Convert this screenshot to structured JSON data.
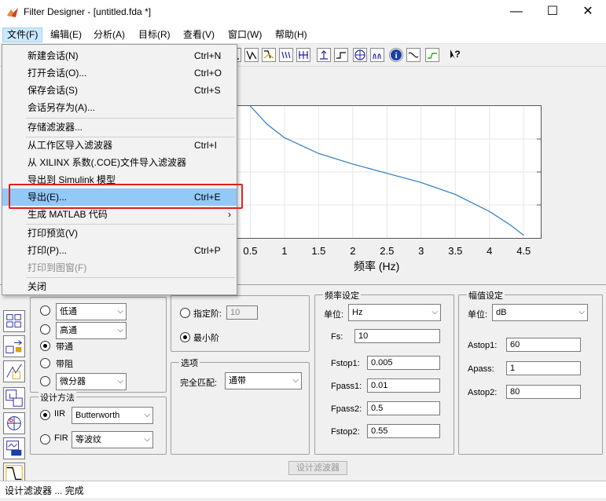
{
  "window": {
    "title": "Filter Designer -  [untitled.fda *]",
    "minimize": "—",
    "maximize": "☐",
    "close": "✕"
  },
  "menubar": [
    "文件(F)",
    "编辑(E)",
    "分析(A)",
    "目标(R)",
    "查看(V)",
    "窗口(W)",
    "帮助(H)"
  ],
  "file_menu": {
    "items": [
      {
        "label": "新建会话(N)",
        "shortcut": "Ctrl+N"
      },
      {
        "label": "打开会话(O)...",
        "shortcut": "Ctrl+O"
      },
      {
        "label": "保存会话(S)",
        "shortcut": "Ctrl+S"
      },
      {
        "label": "会话另存为(A)...",
        "shortcut": ""
      },
      {
        "label": "存储滤波器...",
        "shortcut": ""
      },
      {
        "label": "从工作区导入滤波器",
        "shortcut": "Ctrl+I"
      },
      {
        "label": "从 XILINX 系数(.COE)文件导入滤波器",
        "shortcut": ""
      },
      {
        "label": "导出到 Simulink 模型",
        "shortcut": ""
      },
      {
        "label": "导出(E)...",
        "shortcut": "Ctrl+E"
      },
      {
        "label": "生成 MATLAB 代码",
        "shortcut": "›"
      },
      {
        "label": "打印预览(V)",
        "shortcut": ""
      },
      {
        "label": "打印(P)...",
        "shortcut": "Ctrl+P"
      },
      {
        "label": "打印到图窗(F)",
        "shortcut": ""
      },
      {
        "label": "关闭",
        "shortcut": ""
      }
    ]
  },
  "chart": {
    "xlabel": "频率 (Hz)",
    "xticks": [
      "0.5",
      "1",
      "1.5",
      "2",
      "2.5",
      "3",
      "3.5",
      "4",
      "4.5"
    ]
  },
  "chart_data": {
    "type": "line",
    "xlabel": "频率 (Hz)",
    "xlim": [
      0.3,
      4.75
    ],
    "x": [
      0.5,
      0.75,
      1.0,
      1.5,
      2.0,
      2.5,
      3.0,
      3.5,
      4.0,
      4.3,
      4.5
    ],
    "y": [
      1.0,
      0.86,
      0.76,
      0.64,
      0.56,
      0.49,
      0.42,
      0.33,
      0.2,
      0.1,
      0.02
    ],
    "grid": true
  },
  "response_type": {
    "options": [
      "低通",
      "高通",
      "带通",
      "带阻",
      "微分器"
    ],
    "selected": "带通"
  },
  "design_method": {
    "title": "设计方法",
    "iir_label": "IIR",
    "iir_value": "Butterworth",
    "fir_label": "FIR",
    "fir_value": "等波纹",
    "selected": "IIR"
  },
  "filter_order": {
    "specify_label": "指定阶:",
    "specify_value": "10",
    "min_label": "最小阶",
    "selected": "最小阶"
  },
  "options": {
    "title": "选项",
    "match_label": "完全匹配:",
    "match_value": "通带"
  },
  "freq_spec": {
    "title": "频率设定",
    "unit_label": "单位:",
    "unit_value": "Hz",
    "fs_label": "Fs:",
    "fs_value": "10",
    "fstop1_label": "Fstop1:",
    "fstop1_value": "0.005",
    "fpass1_label": "Fpass1:",
    "fpass1_value": "0.01",
    "fpass2_label": "Fpass2:",
    "fpass2_value": "0.5",
    "fstop2_label": "Fstop2:",
    "fstop2_value": "0.55"
  },
  "mag_spec": {
    "title": "幅值设定",
    "unit_label": "单位:",
    "unit_value": "dB",
    "astop1_label": "Astop1:",
    "astop1_value": "60",
    "apass_label": "Apass:",
    "apass_value": "1",
    "astop2_label": "Astop2:",
    "astop2_value": "80"
  },
  "design_button": "设计滤波器",
  "status": "设计滤波器 ... 完成"
}
